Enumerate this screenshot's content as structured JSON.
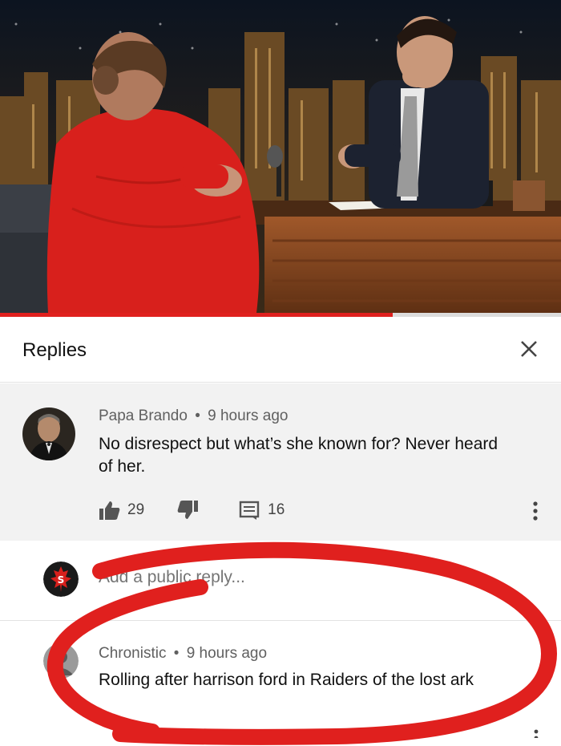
{
  "replies_panel": {
    "title": "Replies"
  },
  "main_comment": {
    "author": "Papa Brando",
    "separator": "•",
    "time": "9 hours ago",
    "text": "No disrespect but what’s she known for? Never heard of her.",
    "likes": "29",
    "replies": "16"
  },
  "add_reply": {
    "placeholder": "Add a public reply..."
  },
  "reply_comment": {
    "author": "Chronistic",
    "separator": "•",
    "time": "9 hours ago",
    "text": "Rolling after harrison ford in Raiders of the lost ark"
  },
  "colors": {
    "annotation_red": "#e0201e",
    "comment_bg": "#f2f2f2",
    "dress_red": "#d8201c",
    "desk_wood": "#8a4a22"
  },
  "icons": [
    "close-icon",
    "thumbs-up-icon",
    "thumbs-down-icon",
    "reply-icon",
    "more-vert-icon"
  ]
}
